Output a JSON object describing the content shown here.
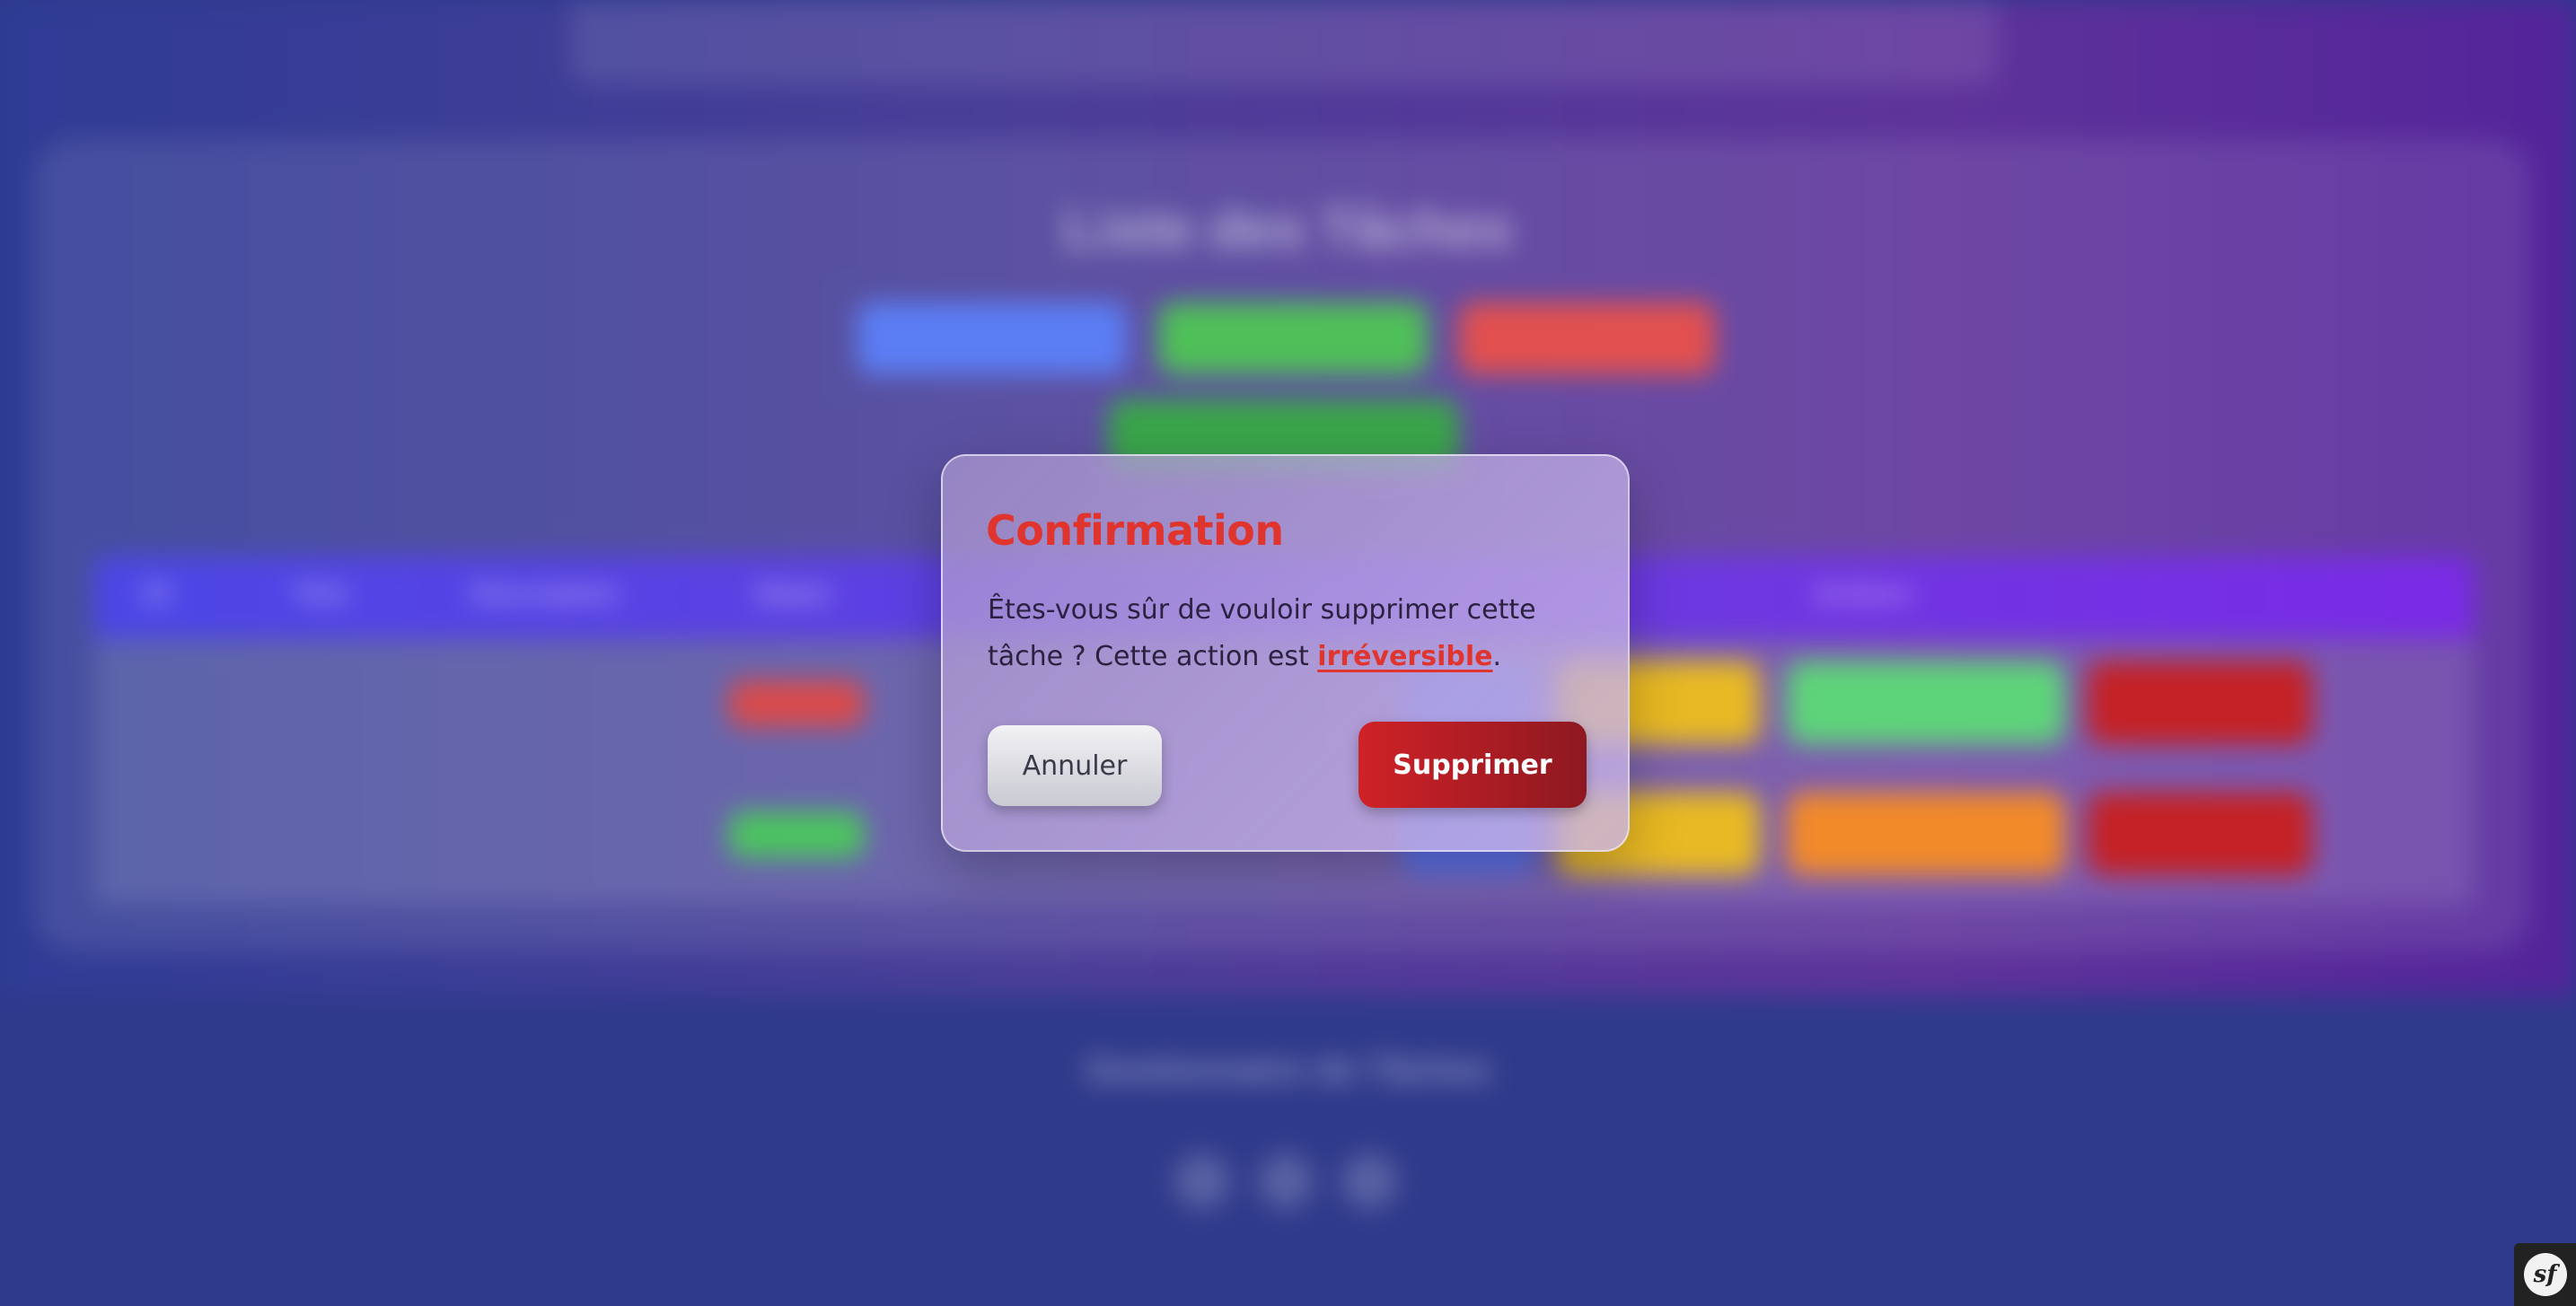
{
  "modal": {
    "title": "Confirmation",
    "message_before": "Êtes-vous sûr de vouloir supprimer cette tâche ? Cette action est ",
    "message_emphasis": "irréversible",
    "message_after": ".",
    "cancel_label": "Annuler",
    "confirm_label": "Supprimer"
  },
  "background": {
    "page_title": "Liste des Tâches",
    "table_headers": [
      "ID",
      "Titre",
      "Description",
      "Statut",
      "Actions"
    ],
    "footer_title": "Gestionnaire de Tâches"
  },
  "colors": {
    "title_red": "#e0352e",
    "confirm_gradient_start": "#cf2227",
    "confirm_gradient_end": "#8e1820",
    "cancel_bg": "#e6e6ea"
  },
  "icons": {
    "debug_toolbar": "symfony-logo-icon"
  }
}
